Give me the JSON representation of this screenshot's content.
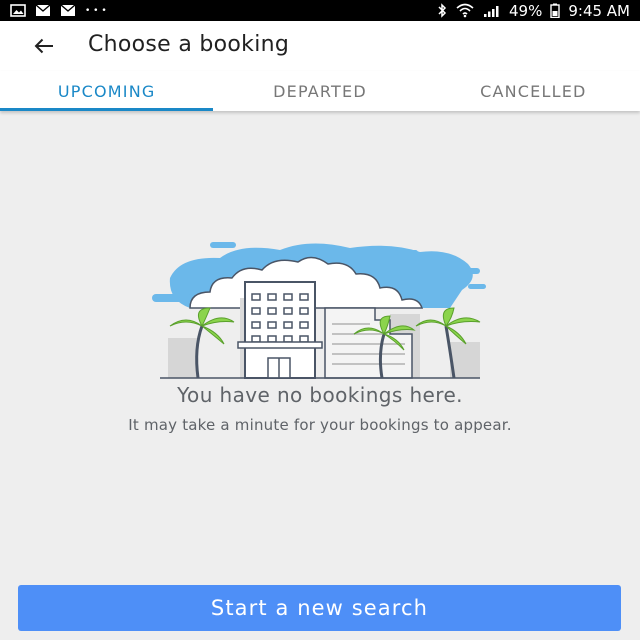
{
  "status_bar": {
    "left_icons": [
      "image-icon",
      "mail-icon",
      "mail-icon",
      "more-dots-icon"
    ],
    "more_dots": "• • •",
    "right_icons": [
      "bluetooth-icon",
      "wifi-icon",
      "signal-icon",
      "battery-icon"
    ],
    "battery_percent": "49%",
    "time": "9:45 AM"
  },
  "header": {
    "back_icon": "arrow-left-icon",
    "title": "Choose a booking"
  },
  "tabs": [
    {
      "label": "UPCOMING",
      "active": true
    },
    {
      "label": "DEPARTED",
      "active": false
    },
    {
      "label": "CANCELLED",
      "active": false
    }
  ],
  "empty_state": {
    "illustration": "hotel-with-palm-trees",
    "title": "You have no bookings here.",
    "subtitle": "It may take a minute for your bookings to appear."
  },
  "cta": {
    "label": "Start a new search"
  },
  "colors": {
    "accent": "#1a88c7",
    "button": "#4e8ff7",
    "background": "#eeeeee",
    "sky": "#6bb8ea"
  }
}
